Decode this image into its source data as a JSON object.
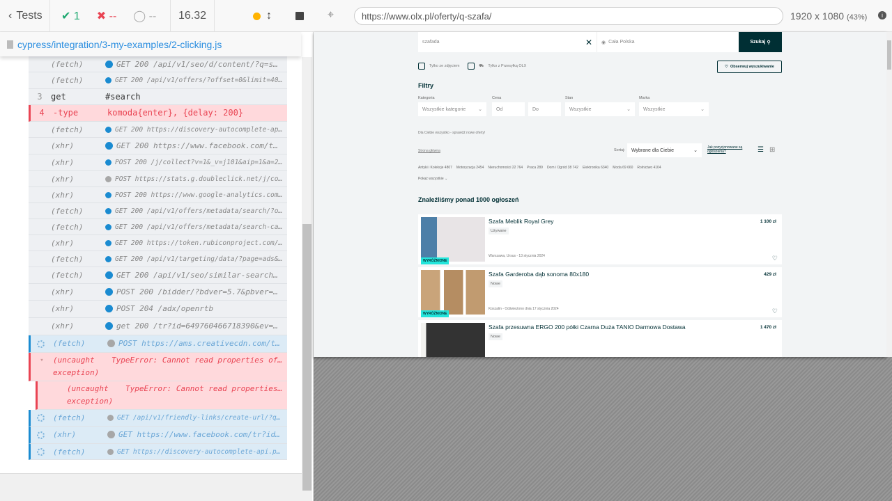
{
  "reporter": {
    "back_label": "Tests",
    "passed": "1",
    "failed": "--",
    "pending": "--",
    "duration": "16.32",
    "file": "cypress/integration/3-my-examples/2-clicking.js"
  },
  "colors": {
    "blue_dot": "#1a8bd1",
    "gray_dot": "#a7a7a7",
    "error": "#e94453",
    "pass": "#1fa971",
    "running": "#ffb300"
  },
  "log": [
    {
      "cmd": "(fetch)",
      "msg": "GET 200 /api/v1/seo/d/content/?q=s…",
      "dot": "blue"
    },
    {
      "cmd": "(fetch)",
      "msg": "GET 200 /api/v1/offers/?offset=0&limit=40…",
      "dot": "blue",
      "small": true
    },
    {
      "num": "3",
      "cmd": "get",
      "msg": "#search",
      "kind": "command"
    },
    {
      "num": "4",
      "cmd": "-type",
      "msg": "komoda{enter}, {delay: 200}",
      "kind": "error"
    },
    {
      "cmd": "(fetch)",
      "msg": "GET 200 https://discovery-autocomplete-ap…",
      "dot": "blue",
      "small": true
    },
    {
      "cmd": "(xhr)",
      "msg": "GET 200 https://www.facebook.com/t…",
      "dot": "blue"
    },
    {
      "cmd": "(xhr)",
      "msg": "POST 200 /j/collect?v=1&_v=j101&aip=1&a=2…",
      "dot": "blue",
      "small": true
    },
    {
      "cmd": "(xhr)",
      "msg": "POST https://stats.g.doubleclick.net/j/co…",
      "dot": "gray",
      "small": true
    },
    {
      "cmd": "(xhr)",
      "msg": "POST 200 https://www.google-analytics.com…",
      "dot": "blue",
      "small": true
    },
    {
      "cmd": "(fetch)",
      "msg": "GET 200 /api/v1/offers/metadata/search/?o…",
      "dot": "blue",
      "small": true
    },
    {
      "cmd": "(fetch)",
      "msg": "GET 200 /api/v1/offers/metadata/search-ca…",
      "dot": "blue",
      "small": true
    },
    {
      "cmd": "(xhr)",
      "msg": "GET 200 https://token.rubiconproject.com/…",
      "dot": "blue",
      "small": true
    },
    {
      "cmd": "(fetch)",
      "msg": "GET 200 /api/v1/targeting/data/?page=ads&…",
      "dot": "blue",
      "small": true
    },
    {
      "cmd": "(fetch)",
      "msg": "GET 200 /api/v1/seo/similar-search…",
      "dot": "blue"
    },
    {
      "cmd": "(xhr)",
      "msg": "POST 200 /bidder/?bdver=5.7&pbver=…",
      "dot": "blue"
    },
    {
      "cmd": "(xhr)",
      "msg": "POST 204 /adx/openrtb",
      "dot": "blue"
    },
    {
      "cmd": "(xhr)",
      "msg": "get 200 /tr?id=649760466718390&ev=…",
      "dot": "blue"
    },
    {
      "cmd": "(fetch)",
      "msg": "POST https://ams.creativecdn.com/t…",
      "dot": "gray",
      "kind": "pending"
    },
    {
      "cmd": "(uncaught exception)",
      "msg": "TypeError: Cannot read properties of u…",
      "kind": "exception"
    },
    {
      "cmd": "(uncaught exception)",
      "msg": "TypeError: Cannot read properties o…",
      "kind": "exception-nested"
    },
    {
      "cmd": "(fetch)",
      "msg": "GET /api/v1/friendly-links/create-url/?qu…",
      "dot": "gray",
      "kind": "pending",
      "small": true
    },
    {
      "cmd": "(xhr)",
      "msg": "GET https://www.facebook.com/tr?id…",
      "dot": "gray",
      "kind": "pending"
    },
    {
      "cmd": "(fetch)",
      "msg": "GET https://discovery-autocomplete-api.pr…",
      "dot": "gray",
      "kind": "pending",
      "small": true
    }
  ],
  "browser": {
    "url": "https://www.olx.pl/oferty/q-szafa/",
    "viewport": "1920 x 1080",
    "zoom": "(43%)"
  },
  "olx": {
    "search_value": "szafada",
    "location": "Cała Polska",
    "search_button": "Szukaj",
    "only_photo": "Tylko ze zdjęciem",
    "only_shipping": "Tylko z Przesyłką OLX",
    "observe": "Obserwuj wyszukiwanie",
    "filters_title": "Filtry",
    "filters": {
      "category_label": "Kategoria",
      "category_value": "Wszystkie kategorie",
      "price_label": "Cena",
      "price_from": "Od",
      "price_to": "Do",
      "state_label": "Stan",
      "state_value": "Wszystkie",
      "brand_label": "Marka",
      "brand_value": "Wszystkie"
    },
    "promo": "Dla Ciebie wszystko - sprawdź nowe oferty!",
    "breadcrumb": "Strona główna",
    "sort_label": "Sortuj:",
    "sort_value": "Wybrane dla Ciebie",
    "positioning_link": "Jak pozycjonowane są ogłoszenia?",
    "categories": [
      "Antyki i Kolekcje 4807",
      "Motoryzacja 2454",
      "Nieruchomości 22 764",
      "Praca 289",
      "Dom i Ogród 38 742",
      "Elektronika 6340",
      "Moda 69 660",
      "Rolnictwo 4104"
    ],
    "show_all": "Pokaż wszystkie",
    "results_title": "Znaleźliśmy ponad 1000 ogłoszeń",
    "listings": [
      {
        "title": "Szafa Meblik Royal Grey",
        "condition": "Używane",
        "location": "Warszawa, Ursus - 13 stycznia 2024",
        "price": "1 100 zł",
        "badge": "WYRÓŻNIONE"
      },
      {
        "title": "Szafa Garderoba dąb sonoma 80x180",
        "condition": "Nowe",
        "location": "Koszalin - Odświeżono dnia 17 stycznia 2024",
        "price": "429 zł",
        "badge": "WYRÓŻNIONE"
      },
      {
        "title": "Szafa przesuwna ERGO 200 półki Czarna Duża TANIO Darmowa Dostawa",
        "condition": "Nowe",
        "price": "1 470 zł"
      }
    ]
  }
}
